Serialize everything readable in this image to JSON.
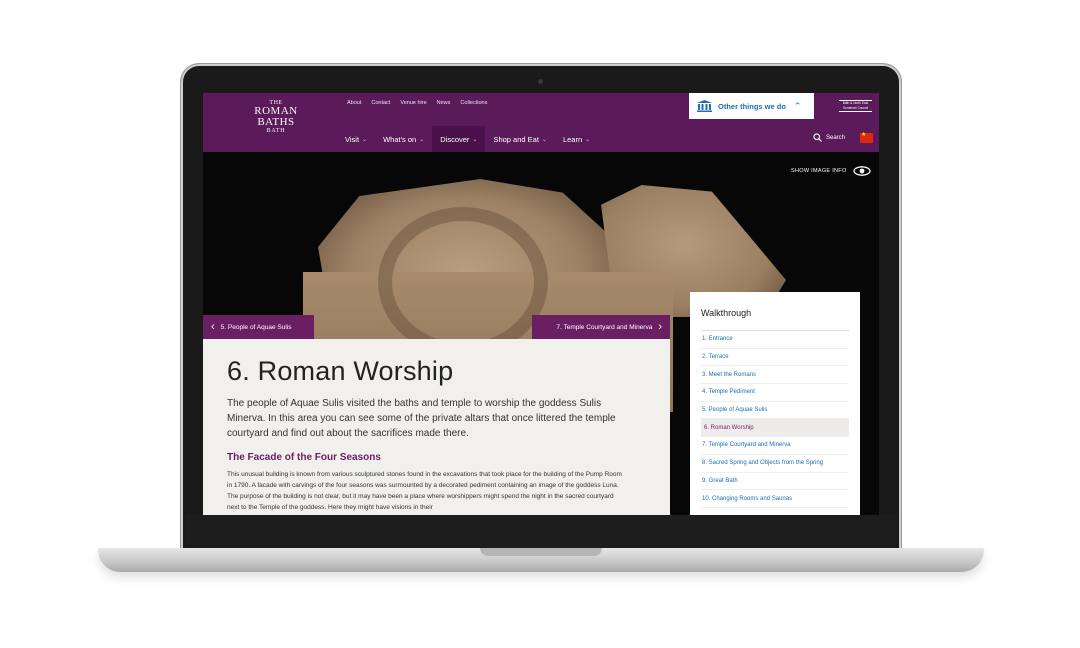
{
  "site": {
    "logo": {
      "line1": "THE",
      "line2": "ROMAN",
      "line3": "BATHS",
      "line4": "BATH"
    },
    "utility_links": [
      "About",
      "Contact",
      "Venue hire",
      "News",
      "Collections"
    ],
    "nav": [
      {
        "label": "Visit",
        "active": false
      },
      {
        "label": "What's on",
        "active": false
      },
      {
        "label": "Discover",
        "active": true
      },
      {
        "label": "Shop and Eat",
        "active": false
      },
      {
        "label": "Learn",
        "active": false
      }
    ],
    "other_things_label": "Other things we do",
    "council_label": "Bath & North East Somerset Council",
    "search_label": "Search"
  },
  "hero": {
    "show_image_info": "SHOW IMAGE INFO",
    "prev_label": "5. People of Aquae Sulis",
    "next_label": "7. Temple Courtyard and Minerva"
  },
  "content": {
    "title": "6. Roman Worship",
    "intro": "The people of Aquae Sulis visited the baths and temple to worship the goddess Sulis Minerva. In this area you can see some of the private altars that once littered the temple courtyard and find out about the sacrifices made there.",
    "subheading": "The Facade of the Four Seasons",
    "body": "This unusual building is known from various sculptured stones found in the excavations that took place for the building of the Pump Room in 1790. A facade with carvings of the four seasons was surmounted by a decorated pediment containing an image of the goddess Luna.  The purpose of the building is not clear, but it may have been a place where worshippers might spend the night in the sacred courtyard next to the Temple of the goddess. Here they might have visions in their"
  },
  "walkthrough": {
    "title": "Walkthrough",
    "items": [
      {
        "label": "1. Entrance",
        "current": false
      },
      {
        "label": "2. Terrace",
        "current": false
      },
      {
        "label": "3. Meet the Romans",
        "current": false
      },
      {
        "label": "4. Temple Pediment",
        "current": false
      },
      {
        "label": "5. People of Aquae Sulis",
        "current": false
      },
      {
        "label": "6. Roman Worship",
        "current": true
      },
      {
        "label": "7. Temple Courtyard and Minerva",
        "current": false
      },
      {
        "label": "8. Sacred Spring and Objects from the Spring",
        "current": false
      },
      {
        "label": "9. Great Bath",
        "current": false
      },
      {
        "label": "10. Changing Rooms and Saunas",
        "current": false
      }
    ]
  },
  "colors": {
    "brand_purple": "#5b1a5a",
    "link_blue": "#1a6fb5",
    "accent_purple": "#6a1f62"
  }
}
